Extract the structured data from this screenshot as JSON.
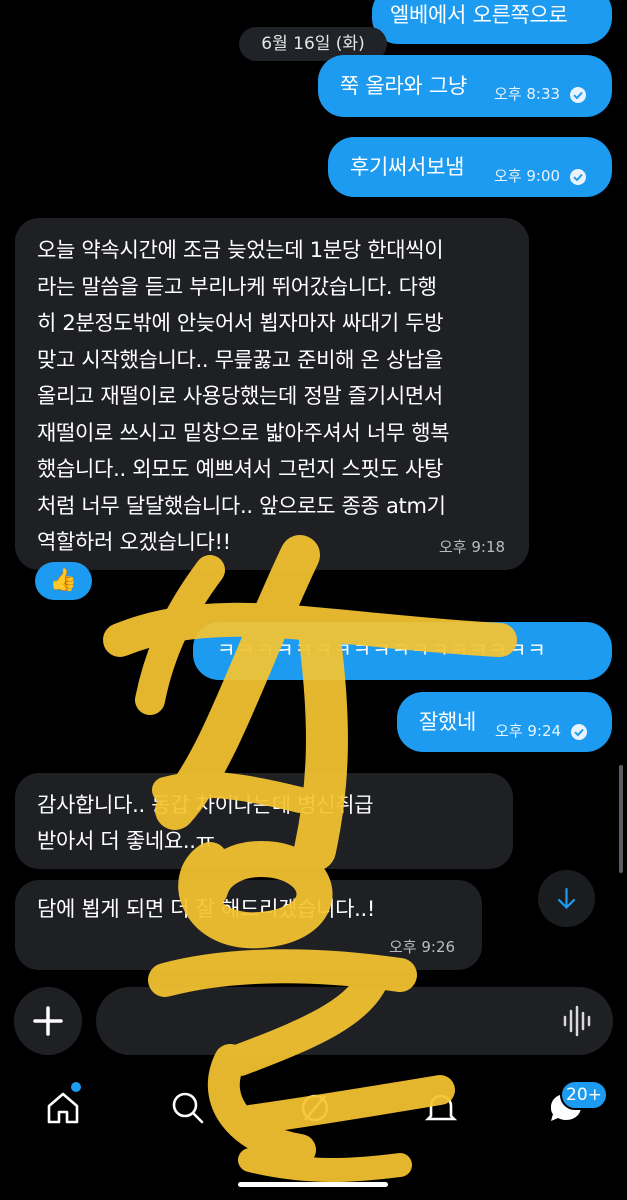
{
  "date_separator": "6월 16일 (화)",
  "messages": [
    {
      "dir": "out",
      "text": "엘베에서 오른쪽으로",
      "time": ""
    },
    {
      "dir": "out",
      "text": "쭉 올라와 그냥",
      "time": "오후 8:33"
    },
    {
      "dir": "out",
      "text": "후기써서보냄",
      "time": "오후 9:00"
    },
    {
      "dir": "in",
      "lines": [
        "오늘 약속시간에 조금 늦었는데 1분당 한대씩이",
        "라는 말씀을 듣고 부리나케 뛰어갔습니다. 다행",
        "히 2분정도밖에 안늦어서 뵙자마자 싸대기 두방",
        "맞고 시작했습니다.. 무릎꿇고 준비해 온 상납을",
        "올리고 재떨이로 사용당했는데 정말 즐기시면서",
        "재떨이로 쓰시고 밑창으로 밟아주셔서 너무 행복",
        "했습니다.. 외모도 예쁘셔서 그런지 스핏도 사탕",
        "처럼 너무 달달했습니다.. 앞으로도 종종 atm기",
        "역할하러 오겠습니다!!"
      ],
      "time": "오후 9:18",
      "reaction": "👍"
    },
    {
      "dir": "out",
      "text": "ㅋㅋㅋㅋㅋㅋㅋㅋㅋㅋㅋㅋㅋㅋㅋㅋㅋ",
      "time": ""
    },
    {
      "dir": "out",
      "text": "잘했네",
      "time": "오후 9:24"
    },
    {
      "dir": "in",
      "lines": [
        "감사합니다.. 동갑 차이나는데 병신취급",
        "받아서 더 좋네요..ㅠ"
      ],
      "time": ""
    },
    {
      "dir": "in",
      "lines": [
        "담에 뵙게 되면 더 잘 해드리겠습니다..!"
      ],
      "time": "오후 9:26"
    }
  ],
  "composer": {
    "add": "add-button",
    "voice": "voice-button"
  },
  "nav": {
    "badge": "20+"
  },
  "colors": {
    "accent": "#1d9bf0",
    "background": "#000000",
    "incoming": "#1f2024",
    "scribble": "#f5c431"
  }
}
